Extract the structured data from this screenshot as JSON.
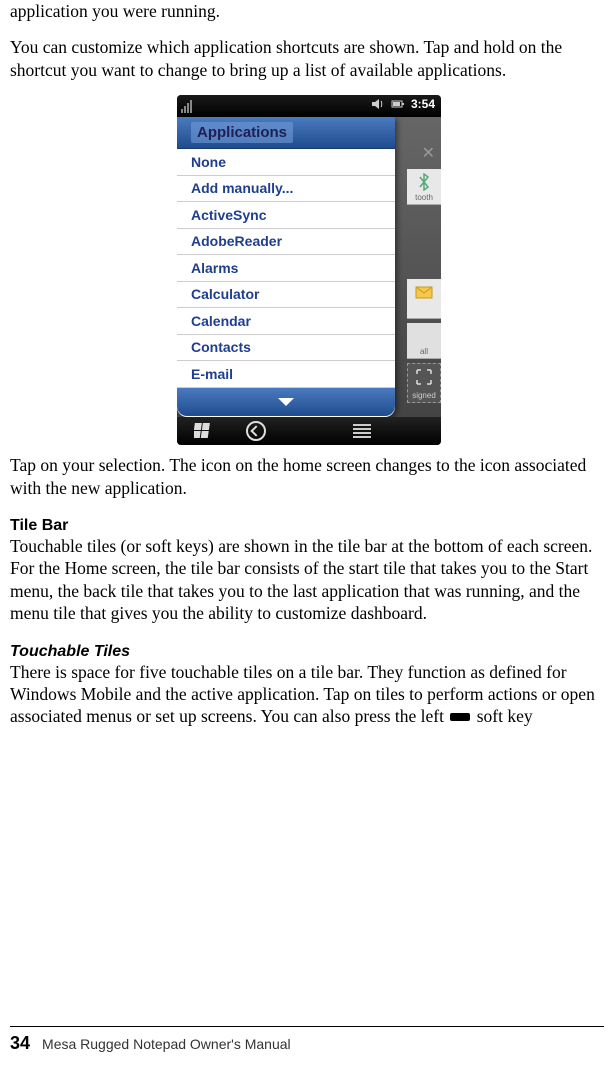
{
  "para1": "application you were running.",
  "para2": "You can customize which application shortcuts are shown. Tap and hold on the shortcut you want to change to bring up a list of available applications.",
  "para3": "Tap on your selection. The icon on the home screen changes to the icon associated with the new application.",
  "heading_tilebar": "Tile Bar",
  "para4": "Touchable tiles (or soft keys) are shown in the tile bar at the bottom of each screen. For the Home screen, the tile bar consists of the start tile that takes you to the Start menu, the back tile that takes you to the last application that was running, and the menu tile that gives you the ability to customize dashboard.",
  "heading_touchable": "Touchable Tiles",
  "para5_a": "There is space for five touchable tiles on a tile bar. They function as defined for Windows Mobile and the active application. Tap on tiles to perform actions or open associated menus or set up screens. You can also press the left ",
  "para5_b": " soft key",
  "footer": {
    "page_num": "34",
    "title": "Mesa Rugged Notepad Owner's Manual"
  },
  "screenshot": {
    "statusbar": {
      "time": "3:54"
    },
    "popup": {
      "header": "Applications",
      "items": [
        "None",
        "Add manually...",
        "ActiveSync",
        "AdobeReader",
        "Alarms",
        "Calculator",
        "Calendar",
        "Contacts",
        "E-mail"
      ]
    },
    "side_labels": {
      "tooth": "tooth",
      "all": "all",
      "signed": "signed"
    }
  }
}
